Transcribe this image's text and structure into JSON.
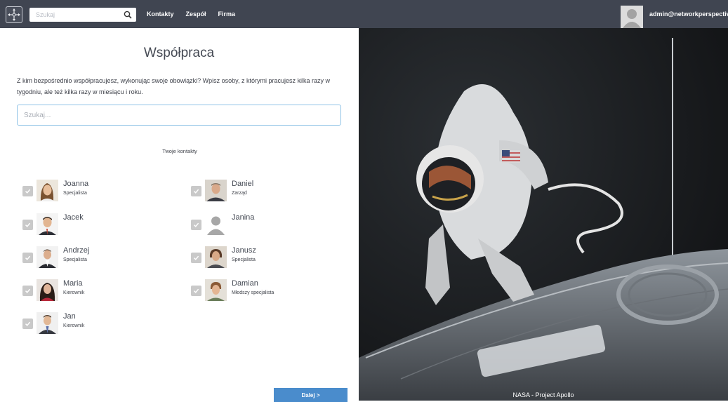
{
  "topbar": {
    "logo_icon": "network-move-icon",
    "search_placeholder": "Szukaj",
    "search_icon": "search-icon",
    "nav": [
      "Kontakty",
      "Zespół",
      "Firma"
    ],
    "user_email": "admin@networkperspective.io"
  },
  "main": {
    "title": "Współpraca",
    "description": "Z kim bezpośrednio współpracujesz, wykonując swoje obowiązki? Wpisz osoby, z którymi pracujesz kilka razy w tygodniu, ale też kilka razy w miesiącu i roku.",
    "search_placeholder": "Szukaj...",
    "contacts_label": "Twoje kontakty",
    "next_label": "Dalej >"
  },
  "contacts": [
    {
      "name": "Joanna",
      "role": "Specjalista",
      "checked": true
    },
    {
      "name": "Daniel",
      "role": "Zarząd",
      "checked": true
    },
    {
      "name": "Jacek",
      "role": "",
      "checked": true
    },
    {
      "name": "Janina",
      "role": "",
      "checked": true
    },
    {
      "name": "Andrzej",
      "role": "Specjalista",
      "checked": true
    },
    {
      "name": "Janusz",
      "role": "Specjalista",
      "checked": true
    },
    {
      "name": "Maria",
      "role": "Kierownik",
      "checked": true
    },
    {
      "name": "Damian",
      "role": "Młodszy specjalista",
      "checked": true
    },
    {
      "name": "Jan",
      "role": "Kierownik",
      "checked": true
    }
  ],
  "image": {
    "caption": "NASA - Project Apollo"
  },
  "colors": {
    "topbar": "#404551",
    "accent": "#4a8ccc",
    "checkbox": "#c9c9c9"
  }
}
